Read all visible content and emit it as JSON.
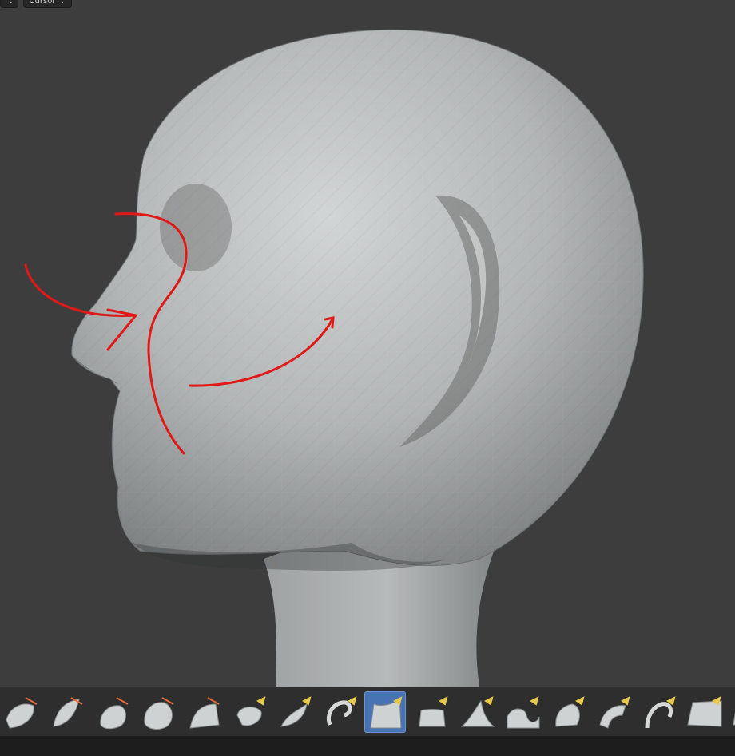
{
  "viewport": {
    "background": "#3d3d3d",
    "header": {
      "left_dropdown_label": "",
      "pivot_dropdown_label": "Cursor"
    },
    "model": {
      "name": "head-mesh",
      "fill": "#b9bcbc",
      "shade": "#8e9191"
    },
    "annotations": {
      "color": "#e01818",
      "strokes": [
        "brow-curve",
        "nose-arrow",
        "cheek-curve",
        "cheek-arrow"
      ]
    }
  },
  "brush_toolbar": {
    "active_index": 8,
    "tools": [
      {
        "icon": "draw-brush-icon"
      },
      {
        "icon": "draw-sharp-brush-icon"
      },
      {
        "icon": "clay-brush-icon"
      },
      {
        "icon": "clay-strips-brush-icon"
      },
      {
        "icon": "layer-brush-icon"
      },
      {
        "icon": "inflate-brush-icon"
      },
      {
        "icon": "blob-brush-icon"
      },
      {
        "icon": "crease-brush-icon"
      },
      {
        "icon": "smooth-brush-icon"
      },
      {
        "icon": "flatten-brush-icon"
      },
      {
        "icon": "fill-brush-icon"
      },
      {
        "icon": "scrape-brush-icon"
      },
      {
        "icon": "multiplane-scrape-brush-icon"
      },
      {
        "icon": "pinch-brush-icon"
      },
      {
        "icon": "grab-brush-icon"
      },
      {
        "icon": "elastic-deform-brush-icon"
      },
      {
        "icon": "snake-hook-brush-icon"
      }
    ]
  },
  "status_bar": {
    "background": "#1d1d1d"
  }
}
